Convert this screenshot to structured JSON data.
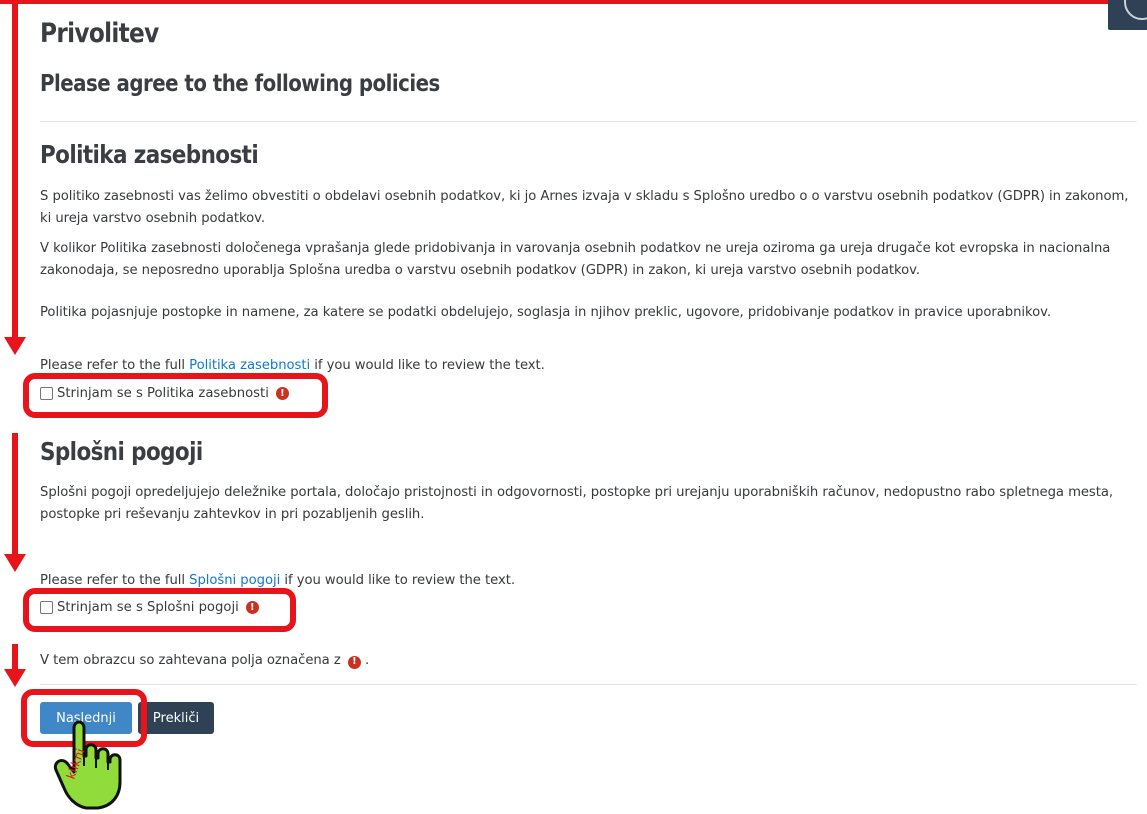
{
  "page": {
    "title": "Privolitev",
    "subtitle": "Please agree to the following policies"
  },
  "policies": [
    {
      "heading": "Politika zasebnosti",
      "paragraphs": [
        "S politiko zasebnosti vas želimo obvestiti o obdelavi osebnih podatkov, ki jo Arnes izvaja v skladu s Splošno uredbo o o varstvu osebnih podatkov (GDPR) in zakonom, ki ureja varstvo osebnih podatkov.",
        "V kolikor Politika zasebnosti določenega vprašanja glede pridobivanja in varovanja osebnih podatkov ne ureja oziroma ga ureja drugače kot evropska in nacionalna zakonodaja, se neposredno uporablja Splošna uredba o varstvu osebnih podatkov (GDPR) in zakon, ki ureja varstvo osebnih podatkov.",
        "Politika pojasnjuje postopke in namene, za katere se podatki obdelujejo, soglasja in njihov preklic, ugovore, pridobivanje podatkov in pravice uporabnikov."
      ],
      "refer_prefix": "Please refer to the full ",
      "refer_link": "Politika zasebnosti",
      "refer_suffix": " if you would like to review the text.",
      "agree_label": "Strinjam se s Politika zasebnosti"
    },
    {
      "heading": "Splošni pogoji",
      "paragraphs": [
        "Splošni pogoji opredeljujejo deležnike portala, določajo pristojnosti in odgovornosti, postopke pri urejanju uporabniških računov, nedopustno rabo spletnega mesta, postopke pri reševanju zahtevkov in pri pozabljenih geslih."
      ],
      "refer_prefix": "Please refer to the full ",
      "refer_link": "Splošni pogoji",
      "refer_suffix": " if you would like to review the text.",
      "agree_label": "Strinjam se s Splošni pogoji"
    }
  ],
  "required_note_prefix": "V tem obrazcu so zahtevana polja označena z",
  "required_note_suffix": ".",
  "buttons": {
    "next": "Naslednji",
    "cancel": "Prekliči"
  },
  "annotation": {
    "click_hint": "klikni",
    "color": "#e8141b"
  },
  "icons": {
    "required": "exclamation-circle-icon",
    "pointer": "pointing-hand-icon"
  }
}
